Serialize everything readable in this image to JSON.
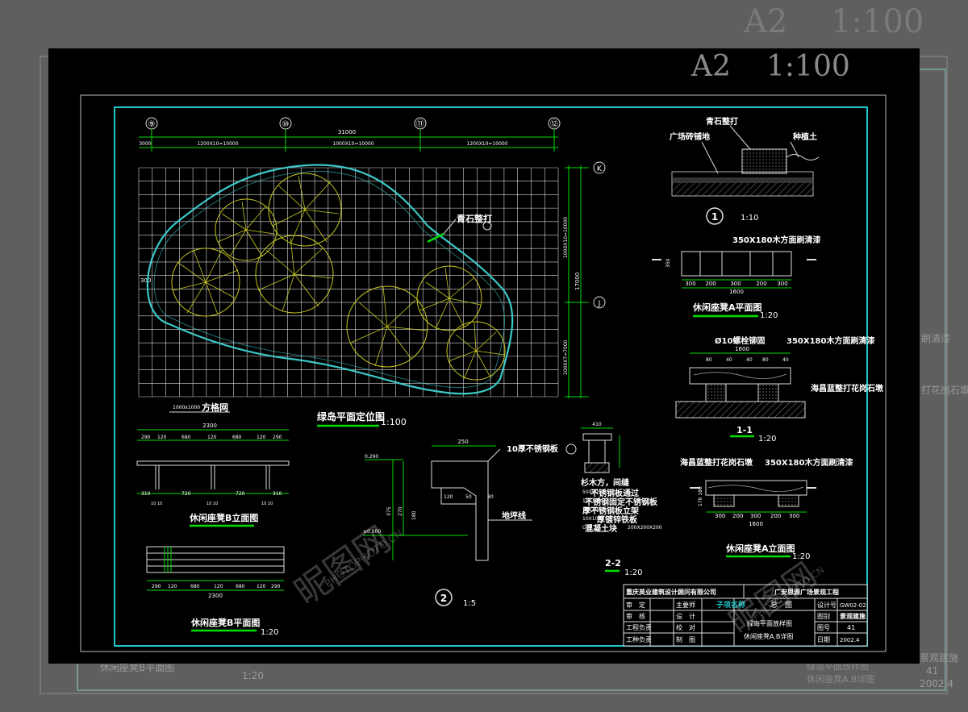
{
  "background_scale": {
    "sheet": "A2",
    "scale": "1:100"
  },
  "sheet_scale": {
    "sheet": "A2",
    "scale": "1:100"
  },
  "plan": {
    "axes": [
      "⑨",
      "⑩",
      "⑪",
      "⑫"
    ],
    "row_axes": [
      "K",
      "J"
    ],
    "dims_top": [
      "3000",
      "1200X10=10000",
      "1000X10=10000",
      "1200X10=10000"
    ],
    "total_dim": "31000",
    "dims_right": [
      "1000X10=10000",
      "17000",
      "1000X7=7000"
    ],
    "left_dim": "300",
    "label_stone": "青石整打",
    "label_grid": "方格网",
    "grid_size": "1000x1000",
    "title": "绿岛平面定位图",
    "scale": "1:100"
  },
  "section1": {
    "label_stone": "青石整打",
    "label_paving": "广场砖铺地",
    "label_soil": "种植土",
    "marker": "1",
    "scale": "1:10"
  },
  "benchA_plan": {
    "top_label": "350X180木方面刷清漆",
    "side": "350",
    "dims": [
      "300",
      "200",
      "300",
      "200",
      "300"
    ],
    "total": "1600",
    "title": "休闲座凳A平面图",
    "scale": "1:20"
  },
  "section_1_1": {
    "bolt": "Ø10螺栓铆固",
    "wood": "350X180木方面刷清漆",
    "top_dims": [
      "1600",
      "80",
      "40",
      "40",
      "80",
      "40"
    ],
    "stone": "海昌蓝整打花岗石墩",
    "title": "1-1",
    "scale": "1:20"
  },
  "benchA_elev": {
    "stone": "海昌蓝整打花岗石墩",
    "wood": "350X180木方面刷清漆",
    "dims": [
      "300",
      "200",
      "300",
      "200",
      "300"
    ],
    "total": "1600",
    "height": "170 180",
    "title": "休闲座凳A立面图",
    "scale": "1:20"
  },
  "benchB_elev": {
    "total": "2300",
    "dims_top": [
      "290",
      "120",
      "680",
      "120",
      "680",
      "120",
      "290"
    ],
    "dims_bot": [
      "310",
      "720",
      "720",
      "310"
    ],
    "ticks": [
      "10 10",
      "10 10",
      "10 10"
    ],
    "title": "休闲座凳B立面图"
  },
  "benchB_plan": {
    "total": "2300",
    "dims": [
      "290",
      "120",
      "680",
      "120",
      "680",
      "120",
      "290"
    ],
    "title": "休闲座凳B平面图",
    "scale": "1:20"
  },
  "section2": {
    "width": "250",
    "plate": "10厚不锈钢板",
    "level_top": "0.290",
    "level_zero": "±0.000",
    "dims": [
      "120",
      "50",
      "80"
    ],
    "heights": [
      "375",
      "270",
      "180"
    ],
    "ground": "地坪线",
    "marker": "2",
    "scale": "1:5"
  },
  "section2_2": {
    "width": "410",
    "notes": [
      "杉木方，间缝",
      "不锈钢板通过",
      "不锈钢固定不锈钢板",
      "厚不锈钢板立架",
      "厚镀锌铁板",
      "混凝土块"
    ],
    "sub_notes": [
      "50X50",
      "10X100",
      "10X100",
      "10X100",
      "C15",
      "200X200X200"
    ],
    "title": "2-2",
    "scale": "1:20"
  },
  "title_block": {
    "company": "重庆英业建筑设计顾问有限公司",
    "project": "广安思源广场景观工程",
    "roles_left": [
      "审　定",
      "审　核",
      "工程负责",
      "工种负责"
    ],
    "roles_mid": [
      "主要师",
      "设　计",
      "校　对",
      "制　图"
    ],
    "item_label": "子项名称",
    "item_value": "总　图",
    "drawing_names": [
      "绿岛平面放样图",
      "休闲座凳A.B详图"
    ],
    "field_labels": [
      "设计号",
      "图别",
      "图号",
      "日期"
    ],
    "field_values": [
      "GW02-02",
      "景观建施",
      "41",
      "2002.4"
    ]
  },
  "watermarks": [
    "昵图网",
    "WWW.NIPIC.CN",
    "PHOTOPHOTO.CN"
  ],
  "colors": {
    "frame": "#1fc8c8",
    "grid": "#ffffff",
    "dim": "#00dd00",
    "plant": "#c8c820",
    "outline": "#3cc8c8",
    "text": "#ffffff"
  }
}
